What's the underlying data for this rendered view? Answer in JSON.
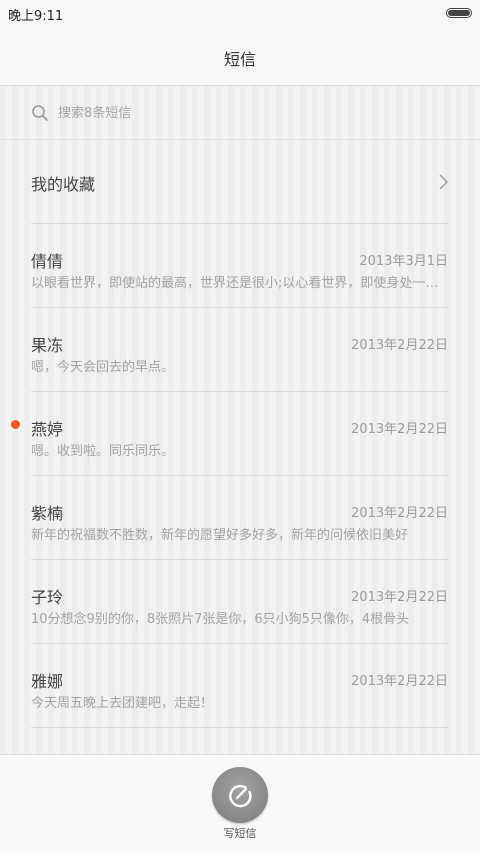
{
  "status_bar": {
    "time": "晚上9:11",
    "battery_level": 1.0
  },
  "header": {
    "title": "短信"
  },
  "search": {
    "placeholder": "搜索8条短信"
  },
  "favorites": {
    "label": "我的收藏"
  },
  "messages": [
    {
      "name": "倩倩",
      "date": "2013年3月1日",
      "preview": "以眼看世界，即使站的最高，世界还是很小;以心看世界，即使身处一隅，世界也会很大",
      "unread": false
    },
    {
      "name": "果冻",
      "date": "2013年2月22日",
      "preview": "嗯，今天会回去的早点。",
      "unread": false
    },
    {
      "name": "燕婷",
      "date": "2013年2月22日",
      "preview": "嗯。收到啦。同乐同乐。",
      "unread": true
    },
    {
      "name": "紫楠",
      "date": "2013年2月22日",
      "preview": "新年的祝福数不胜数，新年的愿望好多好多，新年的问候依旧美好",
      "unread": false
    },
    {
      "name": "子玲",
      "date": "2013年2月22日",
      "preview": "10分想念9别的你，8张照片7张是你，6只小狗5只像你，4根骨头",
      "unread": false
    },
    {
      "name": "雅娜",
      "date": "2013年2月22日",
      "preview": "今天周五晚上去团建吧，走起！",
      "unread": false
    }
  ],
  "compose": {
    "label": "写短信"
  },
  "colors": {
    "unread_dot": "#f25a1e",
    "compose_button": "#8c8c8c"
  },
  "icons": {
    "search": "search-icon",
    "chevron": "chevron-right-icon",
    "compose": "compose-icon",
    "battery": "battery-icon"
  }
}
